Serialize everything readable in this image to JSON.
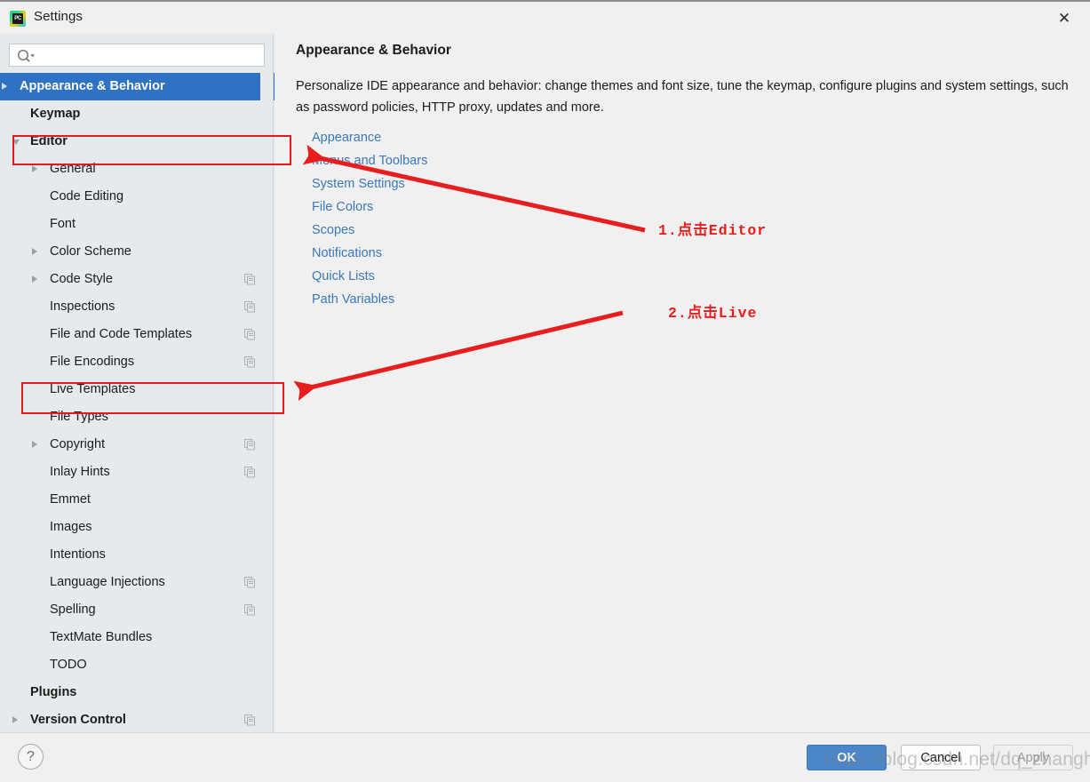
{
  "window": {
    "title": "Settings",
    "app_icon": "pycharm-icon",
    "icon_label": "PC",
    "close_icon": "close-icon"
  },
  "search": {
    "value": "",
    "placeholder": "",
    "icon": "search-icon"
  },
  "sidebar": {
    "items": [
      {
        "label": "Appearance & Behavior",
        "indent": 22,
        "twisty": "collapsed",
        "bold": true,
        "selected": true,
        "badge": false
      },
      {
        "label": "Keymap",
        "indent": 34,
        "twisty": "none",
        "bold": true,
        "selected": false,
        "badge": false
      },
      {
        "label": "Editor",
        "indent": 34,
        "twisty": "expanded",
        "bold": true,
        "selected": false,
        "badge": false
      },
      {
        "label": "General",
        "indent": 56,
        "twisty": "collapsed",
        "bold": false,
        "selected": false,
        "badge": false
      },
      {
        "label": "Code Editing",
        "indent": 56,
        "twisty": "none",
        "bold": false,
        "selected": false,
        "badge": false
      },
      {
        "label": "Font",
        "indent": 56,
        "twisty": "none",
        "bold": false,
        "selected": false,
        "badge": false
      },
      {
        "label": "Color Scheme",
        "indent": 56,
        "twisty": "collapsed",
        "bold": false,
        "selected": false,
        "badge": false
      },
      {
        "label": "Code Style",
        "indent": 56,
        "twisty": "collapsed",
        "bold": false,
        "selected": false,
        "badge": true
      },
      {
        "label": "Inspections",
        "indent": 56,
        "twisty": "none",
        "bold": false,
        "selected": false,
        "badge": true
      },
      {
        "label": "File and Code Templates",
        "indent": 56,
        "twisty": "none",
        "bold": false,
        "selected": false,
        "badge": true
      },
      {
        "label": "File Encodings",
        "indent": 56,
        "twisty": "none",
        "bold": false,
        "selected": false,
        "badge": true
      },
      {
        "label": "Live Templates",
        "indent": 56,
        "twisty": "none",
        "bold": false,
        "selected": false,
        "badge": false
      },
      {
        "label": "File Types",
        "indent": 56,
        "twisty": "none",
        "bold": false,
        "selected": false,
        "badge": false
      },
      {
        "label": "Copyright",
        "indent": 56,
        "twisty": "collapsed",
        "bold": false,
        "selected": false,
        "badge": true
      },
      {
        "label": "Inlay Hints",
        "indent": 56,
        "twisty": "none",
        "bold": false,
        "selected": false,
        "badge": true
      },
      {
        "label": "Emmet",
        "indent": 56,
        "twisty": "none",
        "bold": false,
        "selected": false,
        "badge": false
      },
      {
        "label": "Images",
        "indent": 56,
        "twisty": "none",
        "bold": false,
        "selected": false,
        "badge": false
      },
      {
        "label": "Intentions",
        "indent": 56,
        "twisty": "none",
        "bold": false,
        "selected": false,
        "badge": false
      },
      {
        "label": "Language Injections",
        "indent": 56,
        "twisty": "none",
        "bold": false,
        "selected": false,
        "badge": true
      },
      {
        "label": "Spelling",
        "indent": 56,
        "twisty": "none",
        "bold": false,
        "selected": false,
        "badge": true
      },
      {
        "label": "TextMate Bundles",
        "indent": 56,
        "twisty": "none",
        "bold": false,
        "selected": false,
        "badge": false
      },
      {
        "label": "TODO",
        "indent": 56,
        "twisty": "none",
        "bold": false,
        "selected": false,
        "badge": false
      },
      {
        "label": "Plugins",
        "indent": 34,
        "twisty": "none",
        "bold": true,
        "selected": false,
        "badge": false
      },
      {
        "label": "Version Control",
        "indent": 34,
        "twisty": "collapsed",
        "bold": true,
        "selected": false,
        "badge": true
      }
    ]
  },
  "main": {
    "title": "Appearance & Behavior",
    "description": "Personalize IDE appearance and behavior: change themes and font size, tune the keymap, configure plugins and system settings, such as password policies, HTTP proxy, updates and more.",
    "links": [
      "Appearance",
      "Menus and Toolbars",
      "System Settings",
      "File Colors",
      "Scopes",
      "Notifications",
      "Quick Lists",
      "Path Variables"
    ]
  },
  "footer": {
    "help_label": "?",
    "ok_label": "OK",
    "cancel_label": "Cancel",
    "apply_label": "Apply"
  },
  "annotations": {
    "step1_text": "1.点击Editor",
    "step2_text": "2.点击Live",
    "color": "#e81e1e",
    "watermark": "https://blog.csdn.net/dq_zhanghaifang"
  }
}
